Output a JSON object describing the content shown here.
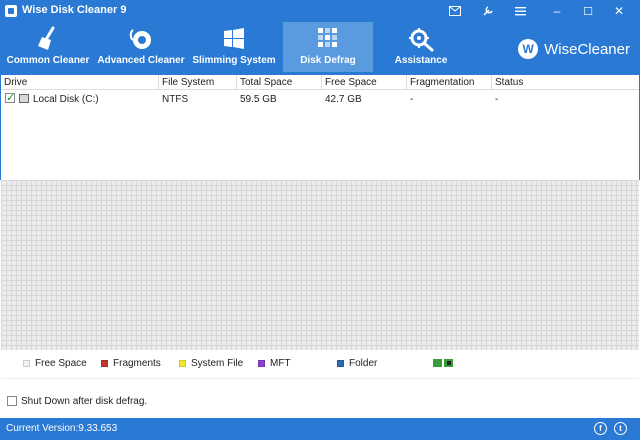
{
  "window": {
    "title": "Wise Disk Cleaner 9",
    "controls": {
      "minimize": "–",
      "maximize": "☐",
      "close": "✕"
    }
  },
  "nav": {
    "items": [
      {
        "label": "Common Cleaner",
        "icon": "broom-icon"
      },
      {
        "label": "Advanced Cleaner",
        "icon": "vacuum-icon"
      },
      {
        "label": "Slimming System",
        "icon": "windows-icon"
      },
      {
        "label": "Disk Defrag",
        "icon": "defrag-icon",
        "active": true
      },
      {
        "label": "Assistance",
        "icon": "gear-wrench-icon"
      }
    ],
    "brand": "WiseCleaner",
    "brand_logo": "W"
  },
  "table": {
    "columns": [
      "Drive",
      "File System",
      "Total Space",
      "Free Space",
      "Fragmentation",
      "Status"
    ],
    "rows": [
      {
        "drive": "Local Disk (C:)",
        "file_system": "NTFS",
        "total_space": "59.5 GB",
        "free_space": "42.7 GB",
        "fragmentation": "-",
        "status": "-",
        "checked": true
      }
    ]
  },
  "legend": {
    "items": [
      {
        "label": "Free Space",
        "color": "#f2f2f2"
      },
      {
        "label": "Fragments",
        "color": "#c0392b"
      },
      {
        "label": "System File",
        "color": "#f5e82a"
      },
      {
        "label": "MFT",
        "color": "#8e3fd1"
      },
      {
        "label": "Folder",
        "color": "#2f6bb5"
      }
    ]
  },
  "options": {
    "shutdown_label": "Shut Down after disk defrag."
  },
  "status": {
    "version": "Current Version:9.33.653"
  },
  "colors": {
    "accent": "#2a79d4",
    "active_tab": "#5a9be0"
  }
}
